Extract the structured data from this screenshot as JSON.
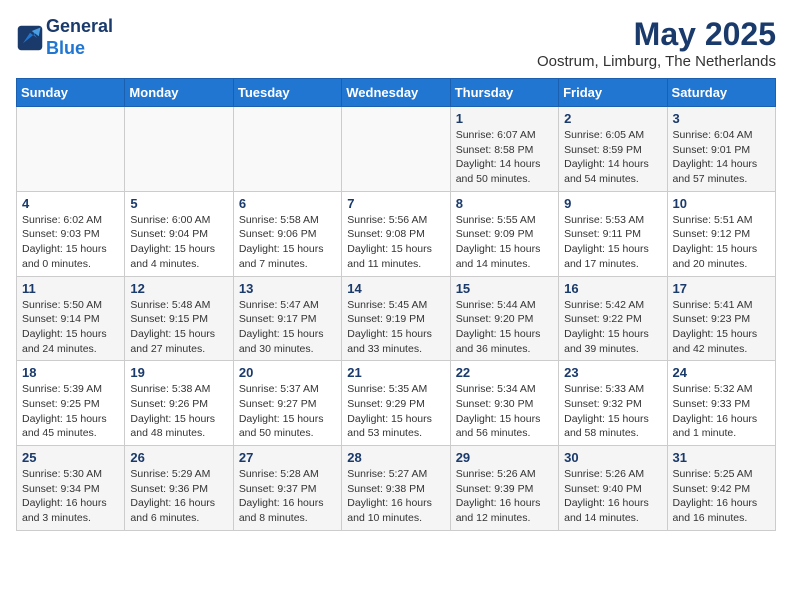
{
  "header": {
    "logo_line1": "General",
    "logo_line2": "Blue",
    "month": "May 2025",
    "location": "Oostrum, Limburg, The Netherlands"
  },
  "weekdays": [
    "Sunday",
    "Monday",
    "Tuesday",
    "Wednesday",
    "Thursday",
    "Friday",
    "Saturday"
  ],
  "weeks": [
    [
      {
        "day": "",
        "info": ""
      },
      {
        "day": "",
        "info": ""
      },
      {
        "day": "",
        "info": ""
      },
      {
        "day": "",
        "info": ""
      },
      {
        "day": "1",
        "info": "Sunrise: 6:07 AM\nSunset: 8:58 PM\nDaylight: 14 hours\nand 50 minutes."
      },
      {
        "day": "2",
        "info": "Sunrise: 6:05 AM\nSunset: 8:59 PM\nDaylight: 14 hours\nand 54 minutes."
      },
      {
        "day": "3",
        "info": "Sunrise: 6:04 AM\nSunset: 9:01 PM\nDaylight: 14 hours\nand 57 minutes."
      }
    ],
    [
      {
        "day": "4",
        "info": "Sunrise: 6:02 AM\nSunset: 9:03 PM\nDaylight: 15 hours\nand 0 minutes."
      },
      {
        "day": "5",
        "info": "Sunrise: 6:00 AM\nSunset: 9:04 PM\nDaylight: 15 hours\nand 4 minutes."
      },
      {
        "day": "6",
        "info": "Sunrise: 5:58 AM\nSunset: 9:06 PM\nDaylight: 15 hours\nand 7 minutes."
      },
      {
        "day": "7",
        "info": "Sunrise: 5:56 AM\nSunset: 9:08 PM\nDaylight: 15 hours\nand 11 minutes."
      },
      {
        "day": "8",
        "info": "Sunrise: 5:55 AM\nSunset: 9:09 PM\nDaylight: 15 hours\nand 14 minutes."
      },
      {
        "day": "9",
        "info": "Sunrise: 5:53 AM\nSunset: 9:11 PM\nDaylight: 15 hours\nand 17 minutes."
      },
      {
        "day": "10",
        "info": "Sunrise: 5:51 AM\nSunset: 9:12 PM\nDaylight: 15 hours\nand 20 minutes."
      }
    ],
    [
      {
        "day": "11",
        "info": "Sunrise: 5:50 AM\nSunset: 9:14 PM\nDaylight: 15 hours\nand 24 minutes."
      },
      {
        "day": "12",
        "info": "Sunrise: 5:48 AM\nSunset: 9:15 PM\nDaylight: 15 hours\nand 27 minutes."
      },
      {
        "day": "13",
        "info": "Sunrise: 5:47 AM\nSunset: 9:17 PM\nDaylight: 15 hours\nand 30 minutes."
      },
      {
        "day": "14",
        "info": "Sunrise: 5:45 AM\nSunset: 9:19 PM\nDaylight: 15 hours\nand 33 minutes."
      },
      {
        "day": "15",
        "info": "Sunrise: 5:44 AM\nSunset: 9:20 PM\nDaylight: 15 hours\nand 36 minutes."
      },
      {
        "day": "16",
        "info": "Sunrise: 5:42 AM\nSunset: 9:22 PM\nDaylight: 15 hours\nand 39 minutes."
      },
      {
        "day": "17",
        "info": "Sunrise: 5:41 AM\nSunset: 9:23 PM\nDaylight: 15 hours\nand 42 minutes."
      }
    ],
    [
      {
        "day": "18",
        "info": "Sunrise: 5:39 AM\nSunset: 9:25 PM\nDaylight: 15 hours\nand 45 minutes."
      },
      {
        "day": "19",
        "info": "Sunrise: 5:38 AM\nSunset: 9:26 PM\nDaylight: 15 hours\nand 48 minutes."
      },
      {
        "day": "20",
        "info": "Sunrise: 5:37 AM\nSunset: 9:27 PM\nDaylight: 15 hours\nand 50 minutes."
      },
      {
        "day": "21",
        "info": "Sunrise: 5:35 AM\nSunset: 9:29 PM\nDaylight: 15 hours\nand 53 minutes."
      },
      {
        "day": "22",
        "info": "Sunrise: 5:34 AM\nSunset: 9:30 PM\nDaylight: 15 hours\nand 56 minutes."
      },
      {
        "day": "23",
        "info": "Sunrise: 5:33 AM\nSunset: 9:32 PM\nDaylight: 15 hours\nand 58 minutes."
      },
      {
        "day": "24",
        "info": "Sunrise: 5:32 AM\nSunset: 9:33 PM\nDaylight: 16 hours\nand 1 minute."
      }
    ],
    [
      {
        "day": "25",
        "info": "Sunrise: 5:30 AM\nSunset: 9:34 PM\nDaylight: 16 hours\nand 3 minutes."
      },
      {
        "day": "26",
        "info": "Sunrise: 5:29 AM\nSunset: 9:36 PM\nDaylight: 16 hours\nand 6 minutes."
      },
      {
        "day": "27",
        "info": "Sunrise: 5:28 AM\nSunset: 9:37 PM\nDaylight: 16 hours\nand 8 minutes."
      },
      {
        "day": "28",
        "info": "Sunrise: 5:27 AM\nSunset: 9:38 PM\nDaylight: 16 hours\nand 10 minutes."
      },
      {
        "day": "29",
        "info": "Sunrise: 5:26 AM\nSunset: 9:39 PM\nDaylight: 16 hours\nand 12 minutes."
      },
      {
        "day": "30",
        "info": "Sunrise: 5:26 AM\nSunset: 9:40 PM\nDaylight: 16 hours\nand 14 minutes."
      },
      {
        "day": "31",
        "info": "Sunrise: 5:25 AM\nSunset: 9:42 PM\nDaylight: 16 hours\nand 16 minutes."
      }
    ]
  ]
}
